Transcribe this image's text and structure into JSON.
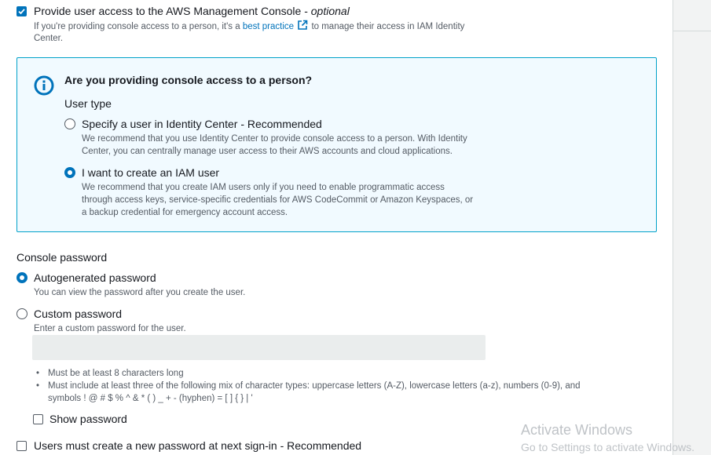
{
  "console_access": {
    "checked": true,
    "label": "Provide user access to the AWS Management Console - ",
    "label_optional": "optional",
    "desc_prefix": "If you're providing console access to a person, it's a ",
    "link": "best practice",
    "desc_suffix": " to manage their access in IAM Identity",
    "desc_line2": "Center."
  },
  "info_box": {
    "icon": "info-icon",
    "title": "Are you providing console access to a person?",
    "user_type_label": "User type",
    "options": [
      {
        "label": "Specify a user in Identity Center - Recommended",
        "selected": false,
        "desc_lines": [
          "We recommend that you use Identity Center to provide console access to a person. With Identity",
          "Center, you can centrally manage user access to their AWS accounts and cloud applications."
        ]
      },
      {
        "label": "I want to create an IAM user",
        "selected": true,
        "desc_lines": [
          "We recommend that you create IAM users only if you need to enable programmatic access",
          "through access keys, service-specific credentials for AWS CodeCommit or Amazon Keyspaces, or",
          "a backup credential for emergency account access."
        ]
      }
    ]
  },
  "console_password": {
    "heading": "Console password",
    "options": [
      {
        "label": "Autogenerated password",
        "selected": true,
        "desc": "You can view the password after you create the user."
      },
      {
        "label": "Custom password",
        "selected": false,
        "desc": "Enter a custom password for the user."
      }
    ],
    "input_value": "",
    "requirements": [
      "Must be at least 8 characters long",
      "Must include at least three of the following mix of character types: uppercase letters (A-Z), lowercase letters (a-z), numbers (0-9), and",
      "symbols ! @ # $ % ^ & * ( ) _ + - (hyphen) = [ ] { } | '"
    ],
    "show_password_label": "Show password",
    "show_password_checked": false,
    "reset_label": "Users must create a new password at next sign-in - Recommended",
    "reset_checked": false
  },
  "watermark": {
    "title": "Activate Windows",
    "subtitle": "Go to Settings to activate Windows."
  },
  "colors": {
    "accent": "#0073bb",
    "info_bg": "#f1faff",
    "info_border": "#00a1c9",
    "text": "#16191f",
    "muted": "#545b64"
  }
}
